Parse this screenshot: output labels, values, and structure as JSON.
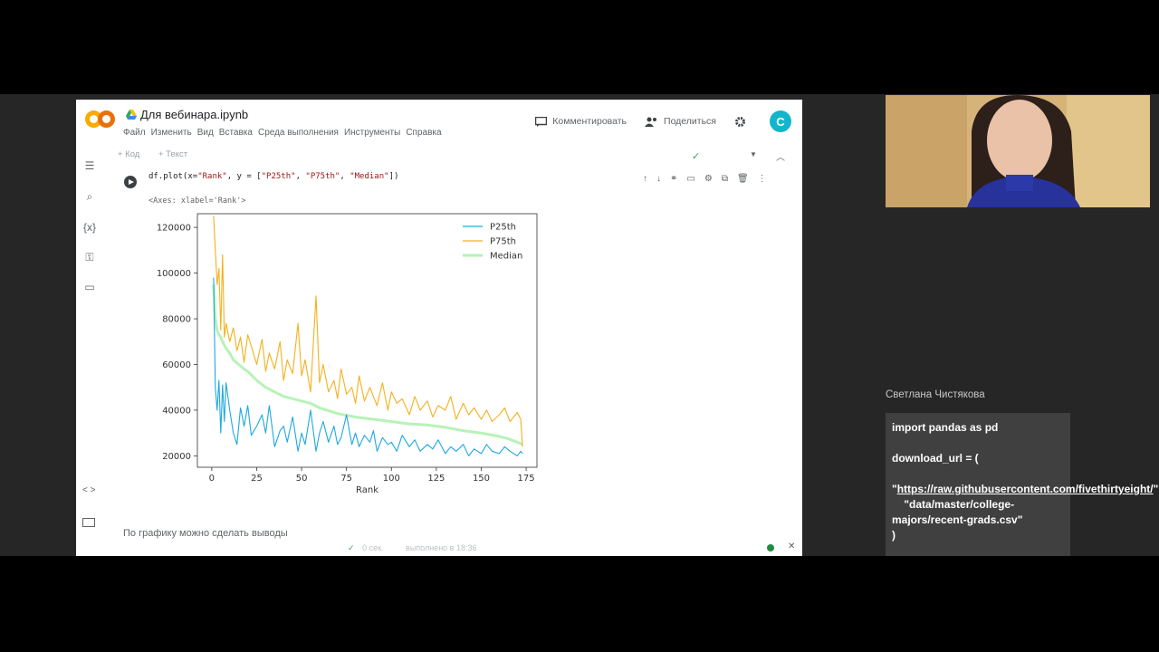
{
  "notebook": {
    "title": "Для вебинара.ipynb",
    "menu": [
      "Файл",
      "Изменить",
      "Вид",
      "Вставка",
      "Среда выполнения",
      "Инструменты",
      "Справка"
    ],
    "comment_label": "Комментировать",
    "share_label": "Поделиться",
    "avatar_letter": "C"
  },
  "toolbar": {
    "add_code": "+ Код",
    "add_text": "+ Текст"
  },
  "cell": {
    "code_prefix": "df.plot(x=",
    "code_x": "\"Rank\"",
    "code_mid": ", y = [",
    "code_y1": "\"P25th\"",
    "code_sep1": ", ",
    "code_y2": "\"P75th\"",
    "code_sep2": ", ",
    "code_y3": "\"Median\"",
    "code_suffix": "])",
    "output_text": "<Axes: xlabel='Rank'>"
  },
  "markdown_cell": {
    "text": "По графику можно сделать выводы"
  },
  "status_bar": {
    "duration": "0 сек.",
    "completed": "выполнено в 18:36"
  },
  "chart_data": {
    "type": "line",
    "xlabel": "Rank",
    "ylabel": "",
    "xlim": [
      -8,
      181
    ],
    "ylim": [
      15000,
      126000
    ],
    "xticks": [
      0,
      25,
      50,
      75,
      100,
      125,
      150,
      175
    ],
    "yticks": [
      20000,
      40000,
      60000,
      80000,
      100000,
      120000
    ],
    "legend_position": "top-right",
    "series": [
      {
        "name": "P25th",
        "color": "#1fa8e0",
        "x": [
          1,
          2,
          3,
          4,
          5,
          6,
          7,
          8,
          10,
          12,
          14,
          16,
          18,
          20,
          22,
          25,
          28,
          30,
          32,
          35,
          38,
          40,
          42,
          45,
          48,
          50,
          52,
          55,
          58,
          60,
          62,
          65,
          68,
          70,
          72,
          75,
          78,
          80,
          82,
          85,
          88,
          90,
          92,
          95,
          98,
          100,
          103,
          106,
          110,
          113,
          116,
          120,
          123,
          126,
          130,
          133,
          136,
          140,
          143,
          146,
          150,
          153,
          156,
          160,
          163,
          166,
          170,
          172,
          173
        ],
        "values": [
          98000,
          50000,
          40000,
          53000,
          30000,
          51000,
          35000,
          52000,
          40000,
          30000,
          25000,
          41000,
          33000,
          42000,
          29000,
          33000,
          38000,
          30000,
          42000,
          24000,
          31000,
          33000,
          26000,
          37000,
          22000,
          30000,
          25000,
          40000,
          22000,
          30000,
          35000,
          26000,
          33000,
          25000,
          28000,
          38000,
          25000,
          30000,
          24000,
          29000,
          26000,
          31000,
          22000,
          28000,
          25000,
          26000,
          22000,
          29000,
          24000,
          27000,
          22000,
          25000,
          23000,
          27000,
          21000,
          24000,
          22000,
          25000,
          20000,
          23000,
          21000,
          25000,
          22000,
          21000,
          24000,
          22000,
          20000,
          22000,
          21000
        ]
      },
      {
        "name": "P75th",
        "color": "#f5b01d",
        "x": [
          1,
          2,
          3,
          4,
          5,
          6,
          7,
          8,
          10,
          12,
          14,
          16,
          18,
          20,
          22,
          25,
          28,
          30,
          32,
          35,
          38,
          40,
          42,
          45,
          48,
          50,
          52,
          55,
          58,
          60,
          62,
          65,
          68,
          70,
          72,
          75,
          78,
          80,
          82,
          85,
          88,
          90,
          92,
          95,
          98,
          100,
          103,
          106,
          110,
          113,
          116,
          120,
          123,
          126,
          130,
          133,
          136,
          140,
          143,
          146,
          150,
          153,
          156,
          160,
          163,
          166,
          170,
          172,
          173
        ],
        "values": [
          125000,
          110000,
          95000,
          102000,
          75000,
          108000,
          72000,
          78000,
          70000,
          76000,
          66000,
          72000,
          61000,
          73000,
          68000,
          60000,
          71000,
          57000,
          65000,
          58000,
          70000,
          53000,
          62000,
          56000,
          78000,
          55000,
          62000,
          48000,
          90000,
          52000,
          60000,
          48000,
          53000,
          45000,
          58000,
          47000,
          50000,
          43000,
          55000,
          44000,
          50000,
          46000,
          42000,
          52000,
          40000,
          48000,
          43000,
          45000,
          38000,
          46000,
          40000,
          44000,
          37000,
          42000,
          40000,
          46000,
          36000,
          43000,
          38000,
          41000,
          36000,
          40000,
          35000,
          38000,
          41000,
          35000,
          39000,
          36000,
          24000
        ]
      },
      {
        "name": "Median",
        "color": "#b6f3b6",
        "x": [
          1,
          2,
          3,
          4,
          5,
          6,
          8,
          10,
          12,
          15,
          18,
          20,
          25,
          30,
          35,
          40,
          45,
          50,
          55,
          60,
          70,
          80,
          90,
          100,
          110,
          120,
          130,
          140,
          150,
          160,
          165,
          170,
          173
        ],
        "values": [
          95000,
          80000,
          75000,
          73000,
          72000,
          70000,
          67000,
          65000,
          62000,
          60000,
          58000,
          57000,
          53000,
          50000,
          48000,
          46000,
          45000,
          44000,
          43000,
          41000,
          38500,
          37000,
          36000,
          35000,
          34000,
          33500,
          32500,
          31000,
          30000,
          28500,
          27500,
          26000,
          25000
        ]
      }
    ]
  },
  "meeting": {
    "participant_name": "Светлана Чистякова",
    "chat_line1": "import pandas as pd",
    "chat_line2": "download_url = (",
    "chat_url_quote_open": "\"",
    "chat_url": "https://raw.githubusercontent.com/fivethirtyeight/",
    "chat_url_quote_close": "\"",
    "chat_line4": "    \"data/master/college-majors/recent-grads.csv\"",
    "chat_line5": ")"
  }
}
